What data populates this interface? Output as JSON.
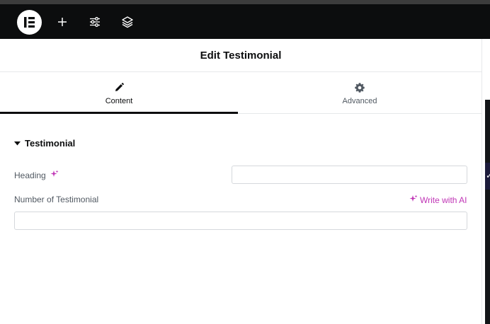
{
  "topbar": {
    "logo_icon": "elementor-logo-icon",
    "buttons": [
      {
        "icon": "plus-icon"
      },
      {
        "icon": "sliders-icon"
      },
      {
        "icon": "layers-icon"
      }
    ]
  },
  "panel": {
    "title": "Edit Testimonial",
    "tabs": [
      {
        "label": "Content",
        "icon": "pencil-icon",
        "active": true
      },
      {
        "label": "Advanced",
        "icon": "gear-icon",
        "active": false
      }
    ],
    "section": {
      "title": "Testimonial",
      "expanded": true
    },
    "controls": {
      "heading": {
        "label": "Heading",
        "value": "",
        "placeholder": ""
      },
      "number": {
        "label": "Number of Testimonial",
        "value": "",
        "placeholder": ""
      },
      "write_ai_label": "Write with AI"
    }
  },
  "colors": {
    "topbar": "#0c0d0e",
    "ai_accent": "#c036b6",
    "text_primary": "#0c0d0e",
    "text_secondary": "#515962",
    "border": "#d5d8dc"
  }
}
